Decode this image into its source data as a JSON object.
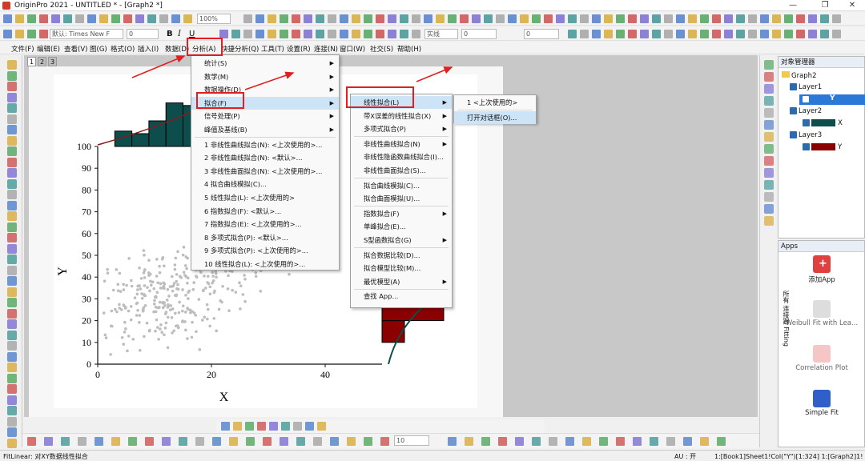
{
  "window": {
    "title": "OriginPro 2021 - UNTITLED * - [Graph2 *]",
    "minimize": "—",
    "restore": "❐",
    "close": "✕"
  },
  "toolbar": {
    "zoom_value": "100%",
    "font_name": "默认: Times New F",
    "font_size": "0",
    "bold": "B",
    "italic": "I",
    "underline": "U",
    "line_style": "实线",
    "line_width": "0",
    "num_field": "0",
    "bottom_size": "10"
  },
  "menubar": {
    "items": [
      "文件(F)",
      "编辑(E)",
      "查看(V)",
      "图(G)",
      "格式(O)",
      "插入(I)",
      "数据(D)",
      "分析(A)",
      "快捷分析(Q)",
      "工具(T)",
      "设置(R)",
      "连接(N)",
      "窗口(W)",
      "社交(S)",
      "帮助(H)"
    ]
  },
  "layer_tabs": [
    "1",
    "2",
    "3"
  ],
  "analysis_menu": {
    "items": [
      {
        "label": "统计(S)",
        "sub": true
      },
      {
        "label": "数学(M)",
        "sub": true
      },
      {
        "label": "数据操作(D)",
        "sub": true
      },
      {
        "label": "拟合(F)",
        "sub": true
      },
      {
        "label": "信号处理(P)",
        "sub": true
      },
      {
        "label": "峰值及基线(B)",
        "sub": true
      },
      {
        "label": "1 非线性曲线拟合(N): <上次使用的>...",
        "sub": false
      },
      {
        "label": "2 非线性曲线拟合(N): <默认>...",
        "sub": false
      },
      {
        "label": "3 非线性曲面拟合(N): <上次使用的>...",
        "sub": false
      },
      {
        "label": "4 拟合曲线模拟(C)...",
        "sub": false
      },
      {
        "label": "5 线性拟合(L): <上次使用的>",
        "sub": false
      },
      {
        "label": "6 指数拟合(F): <默认>...",
        "sub": false
      },
      {
        "label": "7 指数拟合(E): <上次使用的>...",
        "sub": false
      },
      {
        "label": "8 多项式拟合(P): <默认>...",
        "sub": false
      },
      {
        "label": "9 多项式拟合(P): <上次使用的>...",
        "sub": false
      },
      {
        "label": "10 线性拟合(L): <上次使用的>...",
        "sub": false
      }
    ]
  },
  "fit_menu": {
    "items": [
      {
        "label": "线性拟合(L)",
        "sub": true
      },
      {
        "label": "带X误差的线性拟合(X)",
        "sub": true
      },
      {
        "label": "多项式拟合(P)",
        "sub": true
      },
      {
        "label": "非线性曲线拟合(N)",
        "sub": true
      },
      {
        "label": "非线性隐函数曲线拟合(I)...",
        "sub": false
      },
      {
        "label": "非线性曲面拟合(S)...",
        "sub": false
      },
      {
        "label": "拟合曲线模拟(C)...",
        "sub": false
      },
      {
        "label": "拟合曲面模拟(U)...",
        "sub": false
      },
      {
        "label": "指数拟合(F)",
        "sub": true
      },
      {
        "label": "单峰拟合(E)...",
        "sub": false
      },
      {
        "label": "S型函数拟合(G)",
        "sub": true
      },
      {
        "label": "拟合数据比较(D)...",
        "sub": false
      },
      {
        "label": "拟合模型比较(M)...",
        "sub": false
      },
      {
        "label": "最优模型(A)",
        "sub": true
      },
      {
        "label": "查找 App...",
        "sub": false
      }
    ]
  },
  "linear_fit_menu": {
    "items": [
      "1 <上次使用的>",
      "打开对话框(O)..."
    ]
  },
  "graph": {
    "chart_data": {
      "type": "scatter",
      "xlabel": "X",
      "ylabel": "Y",
      "xticks": [
        "0",
        "20",
        "40"
      ],
      "yticks": [
        "0",
        "10",
        "20",
        "30",
        "40",
        "50",
        "60",
        "70",
        "80",
        "90",
        "100"
      ],
      "xlim": [
        0,
        50
      ],
      "ylim": [
        0,
        100
      ],
      "top_histogram": {
        "color": "#0d4d4b",
        "bins": [
          {
            "x0": 3,
            "x1": 6,
            "value": 6
          },
          {
            "x0": 6,
            "x1": 9,
            "value": 5
          },
          {
            "x0": 9,
            "x1": 12,
            "value": 10
          },
          {
            "x0": 12,
            "x1": 15,
            "value": 17
          },
          {
            "x0": 15,
            "x1": 18,
            "value": 16
          }
        ]
      },
      "right_histogram": {
        "color": "#8b0000",
        "bins": [
          {
            "y0": 10,
            "y1": 20,
            "value": 4
          },
          {
            "y0": 20,
            "y1": 30,
            "value": 11
          }
        ]
      },
      "scatter_color": "#bdbdbd"
    }
  },
  "object_manager": {
    "title": "对象管理器",
    "root": "Graph2",
    "layers": [
      {
        "name": "Layer1",
        "plot": "Y",
        "plot_color": "#1f5fbf"
      },
      {
        "name": "Layer2",
        "plot": "X",
        "plot_color": "#0d4d4b"
      },
      {
        "name": "Layer3",
        "plot": "Y",
        "plot_color": "#8b0000"
      }
    ]
  },
  "apps": {
    "title": "Apps",
    "side_tabs": [
      "所有",
      "连接器",
      "Fitting"
    ],
    "items": [
      {
        "label": "添加App",
        "icon": "add-app-icon"
      },
      {
        "label": "Weibull Fit with Lea...",
        "icon": "weibull-icon"
      },
      {
        "label": "Correlation Plot",
        "icon": "correlation-icon"
      },
      {
        "label": "Simple Fit",
        "icon": "simple-fit-icon"
      }
    ]
  },
  "status": {
    "left": "FitLinear: 对XY数据线性拟合",
    "au": "AU : 开",
    "info": "1:[Book1]Sheet1!Col(\"Y\")[1:324]  1:[Graph2]1!1 弧度"
  },
  "colors": {
    "accent_red": "#e02020",
    "highlight": "#cde4f7"
  }
}
